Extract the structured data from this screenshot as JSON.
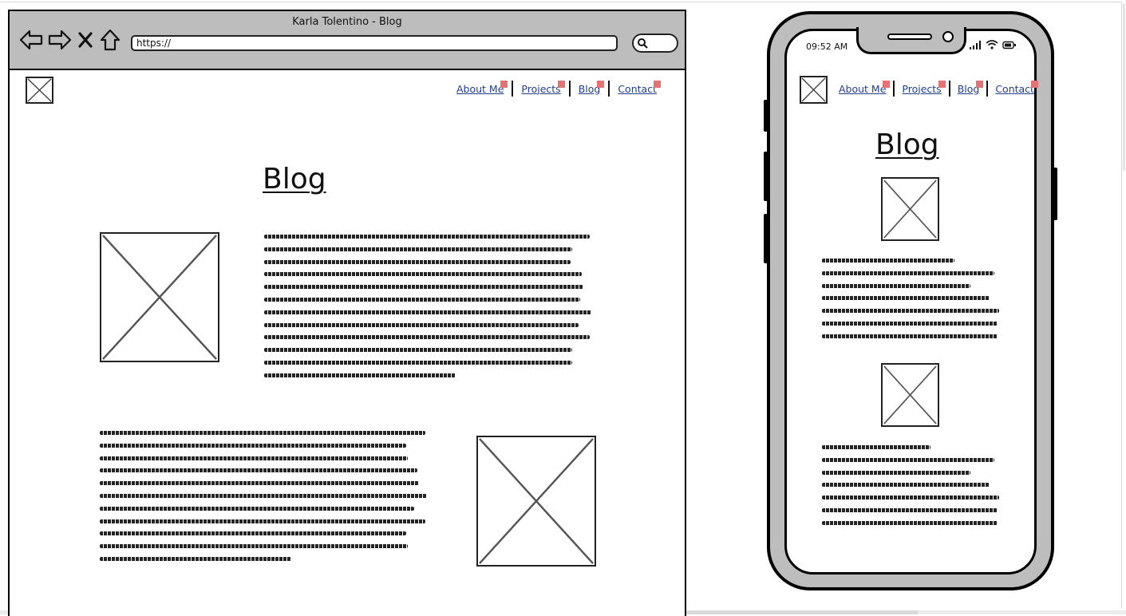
{
  "browser": {
    "title": "Karla Tolentino - Blog",
    "url": "https://",
    "nav_icons": [
      "back-arrow-icon",
      "forward-arrow-icon",
      "close-icon",
      "home-icon"
    ]
  },
  "nav": {
    "items": [
      {
        "label": "About Me"
      },
      {
        "label": "Projects"
      },
      {
        "label": "Blog"
      },
      {
        "label": "Contact"
      }
    ]
  },
  "page": {
    "heading": "Blog"
  },
  "mobile": {
    "status_time": "09:52 AM",
    "status_icons": [
      "signal-icon",
      "wifi-icon",
      "battery-icon"
    ]
  },
  "colors": {
    "browser_chrome": "#bdbdbd",
    "link": "#1f3f8f",
    "link_marker": "#e57373"
  }
}
